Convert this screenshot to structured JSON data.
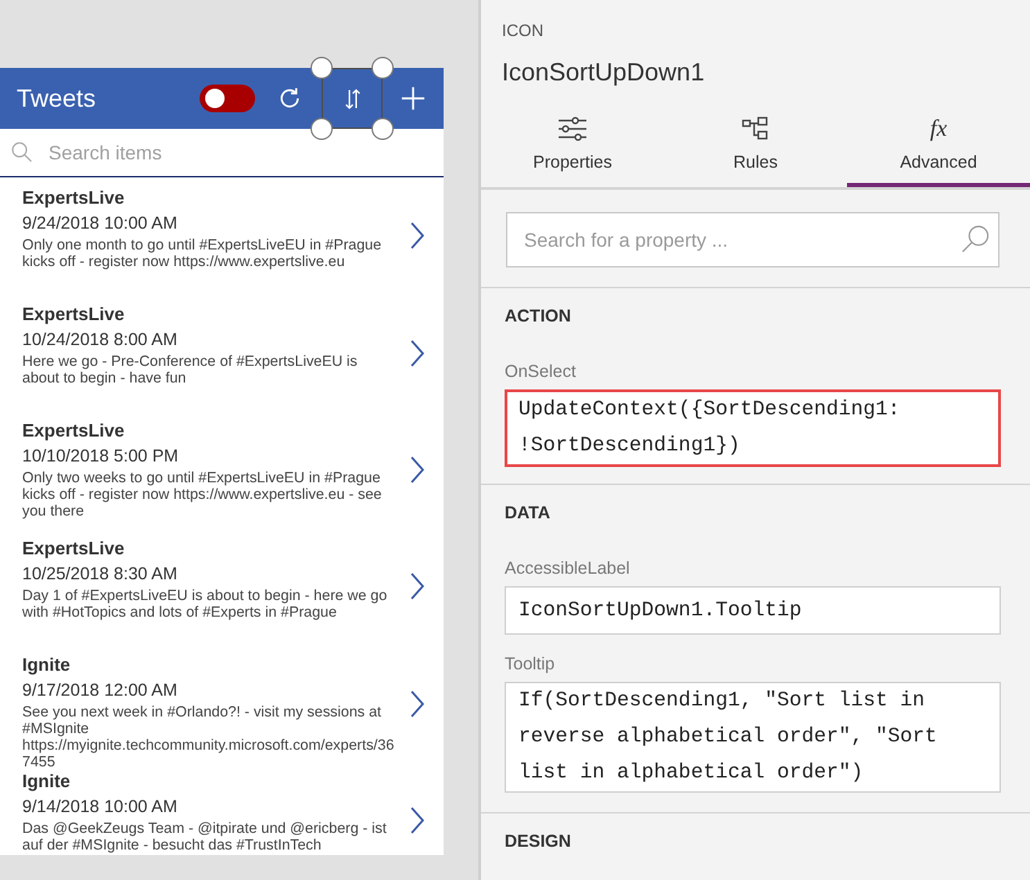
{
  "canvas": {
    "app": {
      "header": {
        "title": "Tweets",
        "toggle": {
          "on": false
        },
        "buttons": [
          {
            "kind": "refresh",
            "selected": false
          },
          {
            "kind": "sort",
            "selected": true
          },
          {
            "kind": "add",
            "selected": false
          }
        ]
      },
      "search": {
        "placeholder": "Search items"
      },
      "gallery": [
        {
          "author": "ExpertsLive",
          "date": "9/24/2018 10:00 AM",
          "text": "Only one month to go until #ExpertsLiveEU in #Prague kicks off - register now https://www.expertslive.eu"
        },
        {
          "author": "ExpertsLive",
          "date": "10/24/2018 8:00 AM",
          "text": "Here we go - Pre-Conference of #ExpertsLiveEU is about to begin - have fun"
        },
        {
          "author": "ExpertsLive",
          "date": "10/10/2018 5:00 PM",
          "text": "Only two weeks to go until #ExpertsLiveEU in #Prague kicks off - register now https://www.expertslive.eu - see you there"
        },
        {
          "author": "ExpertsLive",
          "date": "10/25/2018 8:30 AM",
          "text": "Day 1 of #ExpertsLiveEU is about to begin - here we go with #HotTopics and lots of #Experts in #Prague"
        },
        {
          "author": "Ignite",
          "date": "9/17/2018 12:00 AM",
          "text": "See you next week in #Orlando?! - visit my sessions at #MSIgnite https://myignite.techcommunity.microsoft.com/experts/367455"
        },
        {
          "author": "Ignite",
          "date": "9/14/2018 10:00 AM",
          "text": "Das @GeekZeugs Team - @itpirate und @ericberg - ist auf der #MSIgnite - besucht das #TrustInTech"
        }
      ]
    }
  },
  "properties_panel": {
    "type": "ICON",
    "name": "IconSortUpDown1",
    "tabs": [
      {
        "label": "Properties",
        "kind": "properties",
        "selected": false
      },
      {
        "label": "Rules",
        "kind": "rules",
        "selected": false
      },
      {
        "label": "Advanced",
        "kind": "advanced",
        "symbol": "fx",
        "selected": true
      }
    ],
    "search": {
      "placeholder": "Search for a property ..."
    },
    "sections": [
      {
        "heading": "ACTION",
        "properties": [
          {
            "name": "OnSelect",
            "value": "UpdateContext({SortDescending1: !SortDescending1})",
            "highlighted": true
          }
        ]
      },
      {
        "heading": "DATA",
        "properties": [
          {
            "name": "AccessibleLabel",
            "value": "IconSortUpDown1.Tooltip",
            "highlighted": false
          },
          {
            "name": "Tooltip",
            "value": "If(SortDescending1, \"Sort list in reverse alphabetical order\", \"Sort list in alphabetical order\")",
            "highlighted": false
          }
        ]
      },
      {
        "heading": "DESIGN"
      }
    ]
  }
}
